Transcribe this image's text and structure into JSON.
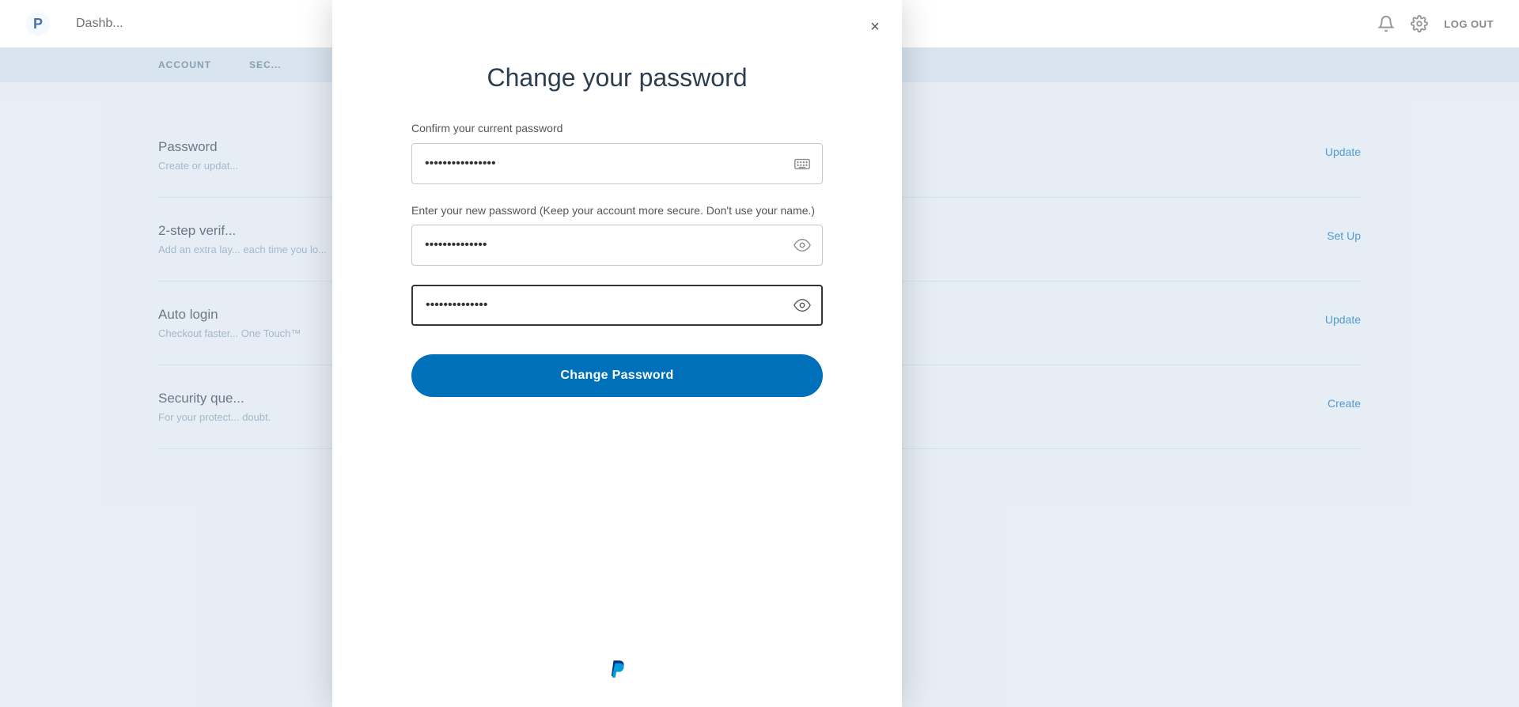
{
  "bg": {
    "nav": {
      "title": "Dashb...",
      "logout_label": "LOG OUT"
    },
    "subnav": {
      "items": [
        "ACCOUNT",
        "SEC..."
      ]
    },
    "rows": [
      {
        "heading": "Password",
        "description": "Create or updat...",
        "action": "Update"
      },
      {
        "heading": "2-step verif...",
        "description": "Add an extra lay... each time you lo...",
        "action": "Set Up"
      },
      {
        "heading": "Auto login",
        "description": "Checkout faster... One Touch™",
        "action": "Update"
      },
      {
        "heading": "Security que...",
        "description": "For your protect... doubt.",
        "action": "Create"
      }
    ]
  },
  "modal": {
    "title": "Change your password",
    "close_label": "×",
    "current_password_label": "Confirm your current password",
    "current_password_value": "•••••••••••••••••",
    "new_password_label": "Enter your new password (Keep your account more secure. Don't use your name.)",
    "new_password_value": "••••••••••••••",
    "confirm_password_value": "••••••••••••••",
    "change_password_button": "Change Password"
  },
  "icons": {
    "close": "×",
    "password_toggle": "⊙",
    "keyboard": "⌨"
  }
}
